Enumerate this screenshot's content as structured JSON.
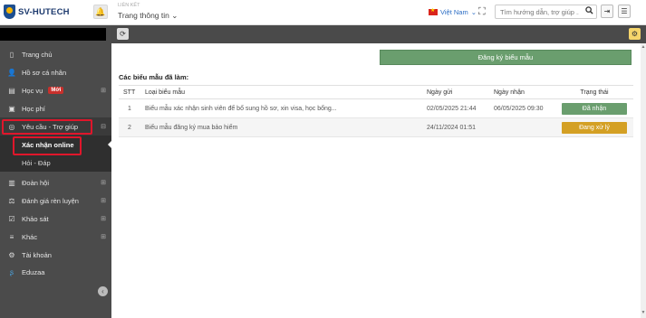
{
  "header": {
    "logo_text": "SV-HUTECH",
    "breadcrumb_caption": "LIÊN KẾT",
    "breadcrumb_title": "Trang thông tin",
    "language": "Việt Nam",
    "search": {
      "placeholder": "Tìm hướng dẫn, trợ giúp ..."
    }
  },
  "sidebar": {
    "items": [
      {
        "label": "Trang chủ",
        "icon": "home-icon"
      },
      {
        "label": "Hồ sơ cá nhân",
        "icon": "user-icon"
      },
      {
        "label": "Học vụ",
        "badge": "Mới",
        "icon": "book-icon"
      },
      {
        "label": "Học phí",
        "icon": "money-icon"
      },
      {
        "label": "Yêu cầu - Trợ giúp",
        "icon": "support-icon"
      },
      {
        "label": "Đoàn hội",
        "icon": "chart-icon"
      },
      {
        "label": "Đánh giá rèn luyện",
        "icon": "scale-icon"
      },
      {
        "label": "Khảo sát",
        "icon": "calendar-check-icon"
      },
      {
        "label": "Khác",
        "icon": "menu-icon"
      },
      {
        "label": "Tài khoản",
        "icon": "gear-icon"
      },
      {
        "label": "Eduzaa",
        "icon": "eduzaa-icon"
      }
    ],
    "sub_items": [
      {
        "label": "Xác nhận online"
      },
      {
        "label": "Hỏi - Đáp"
      }
    ]
  },
  "main": {
    "register_button": "Đăng ký biểu mẫu",
    "section_title": "Các biểu mẫu đã làm:",
    "table": {
      "columns": [
        "STT",
        "Loại biểu mẫu",
        "Ngày gửi",
        "Ngày nhận",
        "Trạng thái"
      ],
      "rows": [
        {
          "stt": "1",
          "type": "Biểu mẫu xác nhận sinh viên để bổ sung hồ sơ, xin visa, học bổng...",
          "sent": "02/05/2025 21:44",
          "received": "06/05/2025 09:30",
          "status": "Đã nhận",
          "status_kind": "done"
        },
        {
          "stt": "2",
          "type": "Biểu mẫu đăng ký mua bảo hiểm",
          "sent": "24/11/2024 01:51",
          "received": "",
          "status": "Đang xử lý",
          "status_kind": "pending"
        }
      ]
    }
  },
  "colors": {
    "sidebar_bg": "#4b4b4b",
    "accent_green": "#6a9e6e",
    "pending_orange": "#d4a024",
    "highlight_red": "#e0162b",
    "badge_red": "#c9302c"
  }
}
